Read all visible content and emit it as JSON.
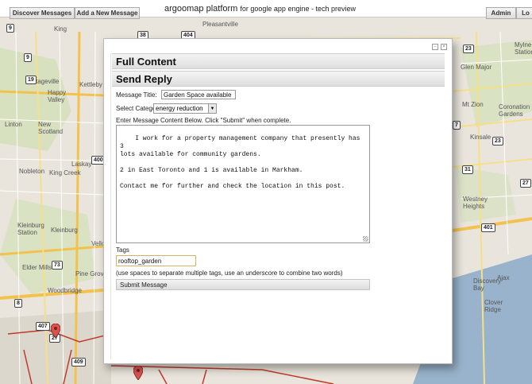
{
  "topbar": {
    "discover_label": "Discover Messages",
    "add_label": "Add a New Message",
    "title": "argoomap platform",
    "subtitle": "for google app engine - tech preview",
    "admin_label": "Admin",
    "logout_label": "Lo"
  },
  "map": {
    "places": [
      "Pleasantville",
      "King",
      "Kettleby",
      "Pottageville",
      "Happy\nValley",
      "Linton",
      "New\nScotland",
      "Laskay",
      "Nobleton",
      "King Creek",
      "Kleinburg\nStation",
      "Kleinburg",
      "Elder Mills",
      "Pine Grove",
      "Woodbridge",
      "Vellore",
      "Glen Major",
      "Mt Zion",
      "Coronation\nGardens",
      "Kinsale",
      "Westney\nHeights",
      "Ajax",
      "Discovery\nBay",
      "Clover\nRidge",
      "Mylne\nStation"
    ],
    "highway_shields": [
      "9",
      "9",
      "19",
      "38",
      "404",
      "400",
      "23",
      "7",
      "27",
      "73",
      "8",
      "407",
      "409",
      "401",
      "27",
      "23",
      "31"
    ]
  },
  "dialog": {
    "ctl_min": "−",
    "ctl_close": "×",
    "full_content_heading": "Full Content",
    "send_reply_heading": "Send Reply",
    "message_title_label": "Message Title:",
    "message_title_value": "Garden Space available",
    "category_label": "Select Category:",
    "category_value": "energy reduction",
    "content_instruction": "Enter Message Content Below. Click \"Submit\" when complete.",
    "content_value": "I work for a property management company that presently has 3\nlots available for community gardens.\n\n2 in East Toronto and 1 is available in Markham.\n\nContact me for further and check the location in this post.",
    "tags_label": "Tags",
    "tags_value": "rooftop_garden",
    "tags_help": "(use spaces to separate multiple tags, use an underscore to combine two words)",
    "submit_label": "Submit Message"
  },
  "colors": {
    "map_bg": "#e9e5dc",
    "highway": "#f2c24d",
    "region_border": "#c0392b",
    "water": "#99b3cc"
  }
}
